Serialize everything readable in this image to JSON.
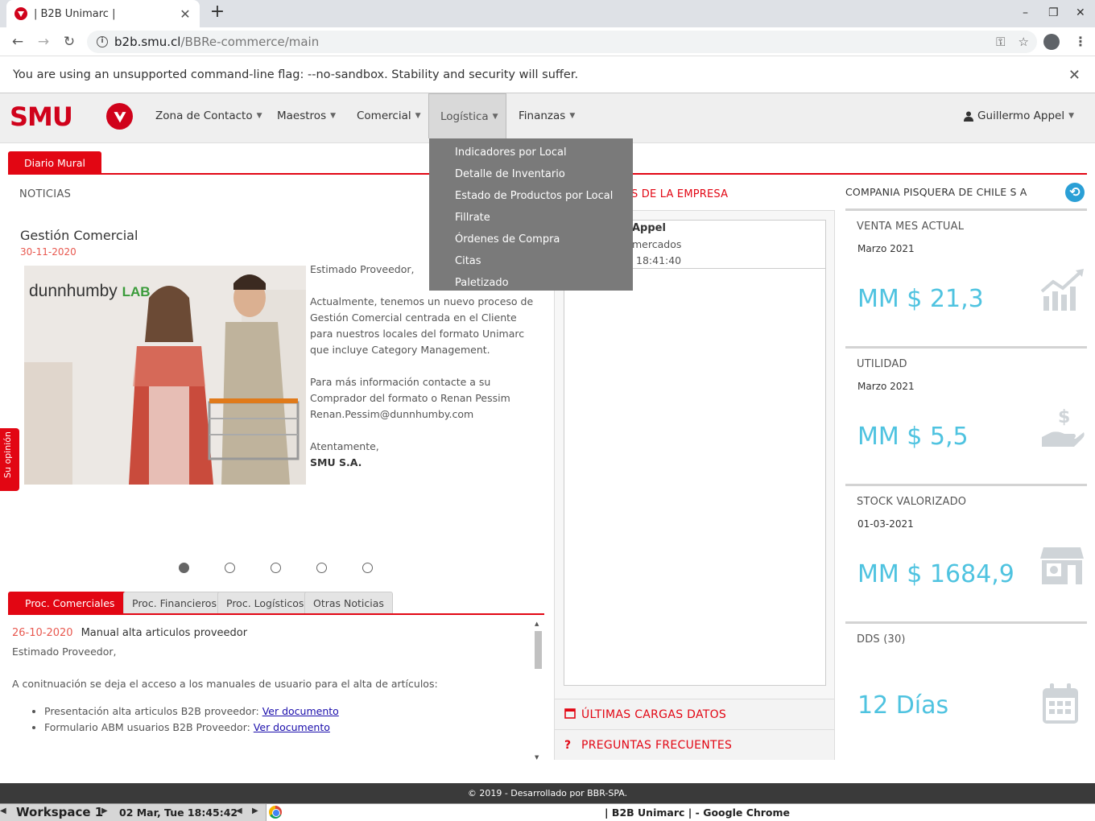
{
  "browser": {
    "tab_title": "| B2B Unimarc |",
    "url_host": "b2b.smu.cl",
    "url_path": "/BBRe-commerce/main",
    "infobar_text": "You are using an unsupported command-line flag: --no-sandbox. Stability and security will suffer."
  },
  "nav": {
    "logo_text": "SMU",
    "items": [
      "Zona de Contacto",
      "Maestros",
      "Comercial",
      "Logística",
      "Finanzas"
    ],
    "user": "Guillermo Appel",
    "active_item": "Logística"
  },
  "dropdown": {
    "items": [
      "Indicadores por Local",
      "Detalle de Inventario",
      "Estado de Productos por Local",
      "Fillrate",
      "Órdenes de Compra",
      "Citas",
      "Paletizado"
    ]
  },
  "mural": {
    "tab_label": "Diario Mural",
    "section_title": "NOTICIAS",
    "side_tab": "Su opinión",
    "news": {
      "heading": "Gestión Comercial",
      "date": "30-11-2020",
      "image_brand": "dunnhumby",
      "image_lab": "LAB",
      "p1": "Estimado Proveedor,",
      "p2": "Actualmente, tenemos un nuevo proceso de Gestión Comercial centrada en el Cliente para nuestros locales del formato Unimarc que incluye Category Management.",
      "p3": "Para más información contacte a su Comprador del formato o Renan Pessim Renan.Pessim@dunnhumby.com",
      "p4": "Atentamente,",
      "p5": "SMU S.A."
    },
    "carousel_count": 5,
    "carousel_active": 1
  },
  "proc": {
    "tabs": [
      "Proc. Comerciales",
      "Proc. Financieros",
      "Proc. Logísticos",
      "Otras Noticias"
    ],
    "date": "26-10-2020",
    "title": "Manual alta articulos proveedor",
    "line1": "Estimado Proveedor,",
    "line2": "A conitnuación se deja el acceso a los manuales de usuario para el alta de artículos:",
    "items": [
      {
        "text": "Presentación alta articulos B2B proveedor: ",
        "link": "Ver documento"
      },
      {
        "text": "Formulario ABM usuarios B2B Proveedor: ",
        "link": "Ver documento"
      }
    ]
  },
  "middle": {
    "header": "S DE LA EMPRESA",
    "line1": "Appel",
    "line2": "mercados",
    "line3": "18:41:40",
    "link1": "ÚLTIMAS CARGAS DATOS",
    "link2": "PREGUNTAS FRECUENTES"
  },
  "right": {
    "company": "COMPANIA PISQUERA DE CHILE S A",
    "kpis": [
      {
        "label": "VENTA MES ACTUAL",
        "period": "Marzo 2021",
        "value": "MM $ 21,3",
        "icon": "chart-growth-icon"
      },
      {
        "label": "UTILIDAD",
        "period": "Marzo 2021",
        "value": "MM $ 5,5",
        "icon": "money-hand-icon"
      },
      {
        "label": "STOCK VALORIZADO",
        "period": "01-03-2021",
        "value": "MM $ 1684,9",
        "icon": "store-icon"
      },
      {
        "label": "DDS (30)",
        "period": "",
        "value": "12 Días",
        "icon": "calendar-icon"
      }
    ],
    "value_color": "#4fc3e0"
  },
  "footer": {
    "text": "© 2019 - Desarrollado por BBR-SPA."
  },
  "taskbar": {
    "workspace": "Workspace 1",
    "datetime": "02 Mar, Tue 18:45:42",
    "window_title": "| B2B Unimarc | - Google Chrome"
  },
  "colors": {
    "brand_red": "#e20613",
    "dropdown_bg": "#7a7a7a"
  }
}
